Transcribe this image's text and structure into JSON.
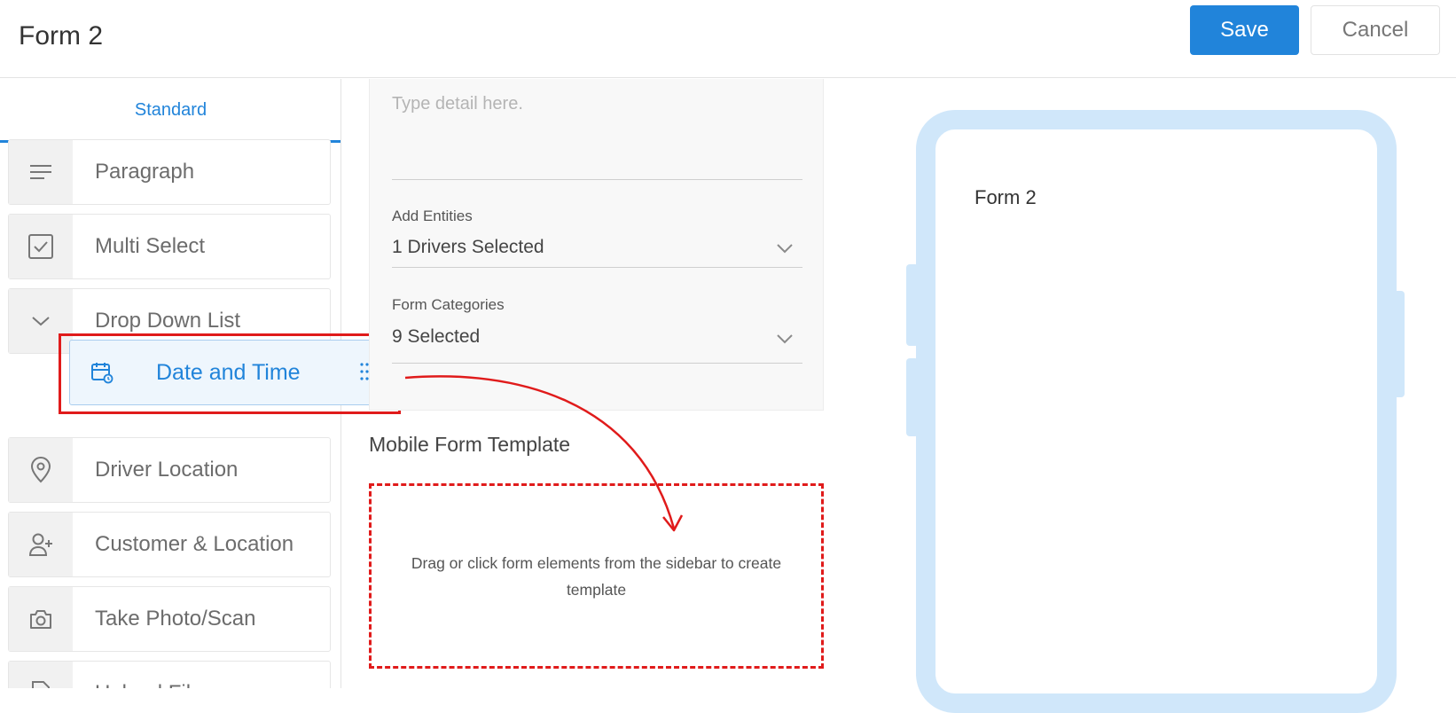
{
  "header": {
    "title": "Form 2",
    "save_label": "Save",
    "cancel_label": "Cancel"
  },
  "sidebar": {
    "tab_label": "Standard",
    "items": [
      {
        "label": "Paragraph",
        "icon": "paragraph-icon"
      },
      {
        "label": "Multi Select",
        "icon": "checkbox-icon"
      },
      {
        "label": "Drop Down List",
        "icon": "chevron-down-icon"
      },
      {
        "label": "Driver Location",
        "icon": "location-pin-icon"
      },
      {
        "label": "Customer & Location",
        "icon": "add-user-icon"
      },
      {
        "label": "Take Photo/Scan",
        "icon": "camera-icon"
      },
      {
        "label": "Upload File",
        "icon": "file-icon"
      }
    ],
    "dragging_item": {
      "label": "Date and Time",
      "icon": "calendar-clock-icon"
    }
  },
  "config": {
    "details_placeholder": "Type detail here.",
    "entities_label": "Add Entities",
    "entities_value": "1 Drivers Selected",
    "categories_label": "Form Categories",
    "categories_value": "9 Selected"
  },
  "template": {
    "title": "Mobile Form Template",
    "dropzone_text": "Drag or click form elements from the sidebar to create template"
  },
  "preview": {
    "form_title": "Form 2"
  },
  "colors": {
    "accent": "#2184da",
    "annotation": "#e01b1b",
    "phone_frame": "#d0e7fa"
  }
}
